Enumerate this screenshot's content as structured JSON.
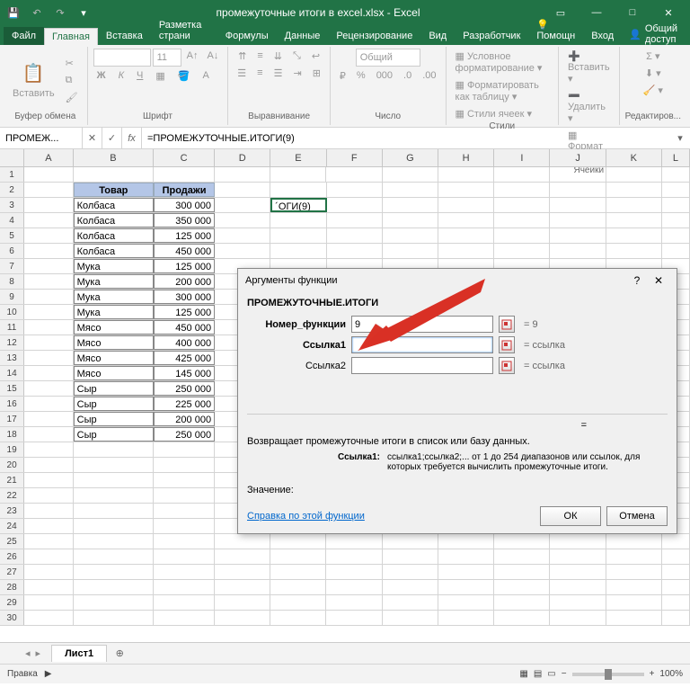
{
  "title": "промежуточные итоги в excel.xlsx - Excel",
  "tabs": {
    "file": "Файл",
    "home": "Главная",
    "insert": "Вставка",
    "layout": "Разметка страни",
    "formulas": "Формулы",
    "data": "Данные",
    "review": "Рецензирование",
    "view": "Вид",
    "developer": "Разработчик",
    "help": "Помощн",
    "login": "Вход"
  },
  "share": "Общий доступ",
  "ribbon": {
    "paste": "Вставить",
    "groups": {
      "clipboard": "Буфер обмена",
      "font": "Шрифт",
      "align": "Выравнивание",
      "number": "Число",
      "styles": "Стили",
      "cells": "Ячейки",
      "editing": "Редактиров..."
    },
    "fontsize": "11",
    "numformat": "Общий",
    "cond": "Условное форматирование",
    "table": "Форматировать как таблицу",
    "cellstyle": "Стили ячеек",
    "insert": "Вставить",
    "delete": "Удалить",
    "format": "Формат"
  },
  "namebox": "ПРОМЕЖ...",
  "formula": "=ПРОМЕЖУТОЧНЫЕ.ИТОГИ(9)",
  "cols": [
    "A",
    "B",
    "C",
    "D",
    "E",
    "F",
    "G",
    "H",
    "I",
    "J",
    "K",
    "L"
  ],
  "table": {
    "h1": "Товар",
    "h2": "Продажи",
    "rows": [
      [
        "Колбаса",
        "300 000"
      ],
      [
        "Колбаса",
        "350 000"
      ],
      [
        "Колбаса",
        "125 000"
      ],
      [
        "Колбаса",
        "450 000"
      ],
      [
        "Мука",
        "125 000"
      ],
      [
        "Мука",
        "200 000"
      ],
      [
        "Мука",
        "300 000"
      ],
      [
        "Мука",
        "125 000"
      ],
      [
        "Мясо",
        "450 000"
      ],
      [
        "Мясо",
        "400 000"
      ],
      [
        "Мясо",
        "425 000"
      ],
      [
        "Мясо",
        "145 000"
      ],
      [
        "Сыр",
        "250 000"
      ],
      [
        "Сыр",
        "225 000"
      ],
      [
        "Сыр",
        "200 000"
      ],
      [
        "Сыр",
        "250 000"
      ]
    ],
    "active_frag": "´ОГИ(9)"
  },
  "sheet": "Лист1",
  "status": "Правка",
  "zoom": "100%",
  "dialog": {
    "title": "Аргументы функции",
    "func": "ПРОМЕЖУТОЧНЫЕ.ИТОГИ",
    "args": [
      {
        "label": "Номер_функции",
        "value": "9",
        "result": "= 9",
        "bold": true
      },
      {
        "label": "Ссылка1",
        "value": "",
        "result": "= ссылка",
        "bold": true
      },
      {
        "label": "Ссылка2",
        "value": "",
        "result": "= ссылка",
        "bold": false
      }
    ],
    "eq": "=",
    "desc": "Возвращает промежуточные итоги в список или базу данных.",
    "arg_key": "Ссылка1:",
    "arg_val": "ссылка1;ссылка2;... от 1 до 254 диапазонов или ссылок, для которых требуется вычислить промежуточные итоги.",
    "value": "Значение:",
    "help": "Справка по этой функции",
    "ok": "ОК",
    "cancel": "Отмена"
  }
}
